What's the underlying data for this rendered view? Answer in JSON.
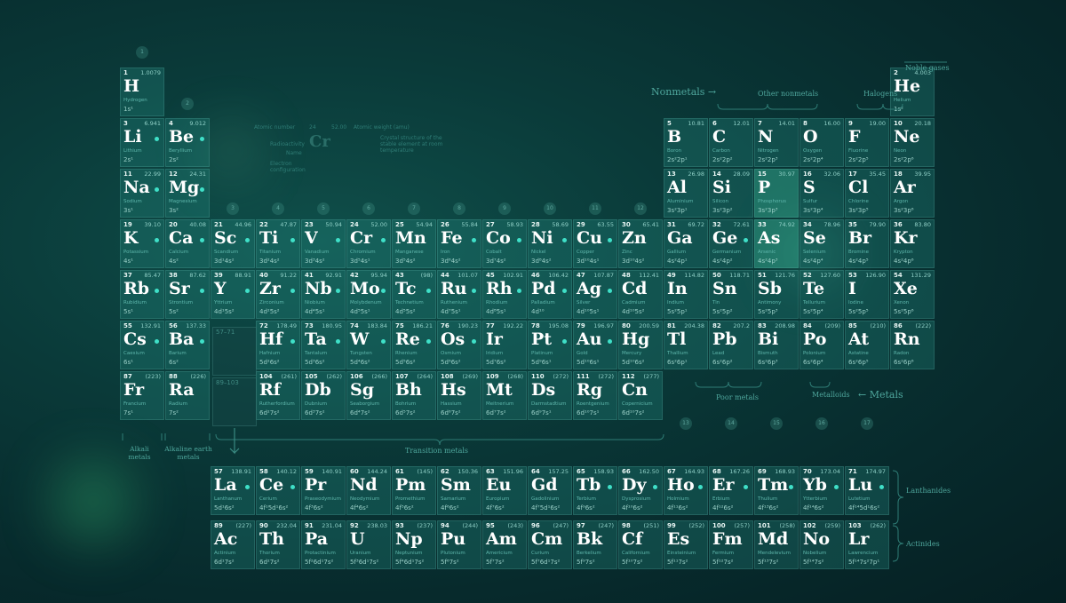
{
  "labels": {
    "noble_gases": "Noble gases",
    "nonmetals": "Nonmetals →",
    "other_nonmetals": "Other nonmetals",
    "halogens": "Halogens",
    "metals": "← Metals",
    "metalloids": "Metalloids",
    "poor_metals": "Poor metals",
    "transition_metals": "Transition metals",
    "alkali_metals": "Alkali metals",
    "alkaline_earth_metals": "Alkaline earth metals",
    "lanthanides": "Lanthanides",
    "actinides": "Actinides",
    "placeholder_la": "57–71",
    "placeholder_ac": "89–103"
  },
  "legend": {
    "atomic_number": "Atomic number",
    "atomic_weight": "Atomic weight (amu)",
    "radioactivity": "Radioactivity",
    "name": "Name",
    "electron_configuration": "Electron configuration",
    "crystal_structure": "Crystal structure of the stable element at room temperature",
    "symbol": "Cr",
    "num": "24",
    "mass": "52.00"
  },
  "group_numbers": [
    {
      "g": "1",
      "c": 0
    },
    {
      "g": "2",
      "c": 1
    },
    {
      "g": "3",
      "c": 2
    },
    {
      "g": "4",
      "c": 3
    },
    {
      "g": "5",
      "c": 4
    },
    {
      "g": "6",
      "c": 5
    },
    {
      "g": "7",
      "c": 6
    },
    {
      "g": "8",
      "c": 7
    },
    {
      "g": "9",
      "c": 8
    },
    {
      "g": "10",
      "c": 9
    },
    {
      "g": "11",
      "c": 10
    },
    {
      "g": "12",
      "c": 11
    },
    {
      "g": "13",
      "c": 12
    },
    {
      "g": "14",
      "c": 13
    },
    {
      "g": "15",
      "c": 14
    },
    {
      "g": "16",
      "c": 15
    },
    {
      "g": "17",
      "c": 16
    }
  ],
  "elements": [
    {
      "n": 1,
      "s": "H",
      "name": "Hydrogen",
      "m": "1.0079",
      "cfg": "1s¹",
      "c": 0,
      "r": 0
    },
    {
      "n": 2,
      "s": "He",
      "name": "Helium",
      "m": "4.003",
      "cfg": "1s²",
      "c": 17,
      "r": 0
    },
    {
      "n": 3,
      "s": "Li",
      "name": "Lithium",
      "m": "6.941",
      "cfg": "2s¹",
      "c": 0,
      "r": 1,
      "dot": true
    },
    {
      "n": 4,
      "s": "Be",
      "name": "Beryllium",
      "m": "9.012",
      "cfg": "2s²",
      "c": 1,
      "r": 1,
      "dot": true
    },
    {
      "n": 5,
      "s": "B",
      "name": "Boron",
      "m": "10.81",
      "cfg": "2s²2p¹",
      "c": 12,
      "r": 1
    },
    {
      "n": 6,
      "s": "C",
      "name": "Carbon",
      "m": "12.01",
      "cfg": "2s²2p²",
      "c": 13,
      "r": 1
    },
    {
      "n": 7,
      "s": "N",
      "name": "Nitrogen",
      "m": "14.01",
      "cfg": "2s²2p³",
      "c": 14,
      "r": 1
    },
    {
      "n": 8,
      "s": "O",
      "name": "Oxygen",
      "m": "16.00",
      "cfg": "2s²2p⁴",
      "c": 15,
      "r": 1
    },
    {
      "n": 9,
      "s": "F",
      "name": "Fluorine",
      "m": "19.00",
      "cfg": "2s²2p⁵",
      "c": 16,
      "r": 1
    },
    {
      "n": 10,
      "s": "Ne",
      "name": "Neon",
      "m": "20.18",
      "cfg": "2s²2p⁶",
      "c": 17,
      "r": 1
    },
    {
      "n": 11,
      "s": "Na",
      "name": "Sodium",
      "m": "22.99",
      "cfg": "3s¹",
      "c": 0,
      "r": 2,
      "dot": true
    },
    {
      "n": 12,
      "s": "Mg",
      "name": "Magnesium",
      "m": "24.31",
      "cfg": "3s²",
      "c": 1,
      "r": 2,
      "dot": true
    },
    {
      "n": 13,
      "s": "Al",
      "name": "Aluminium",
      "m": "26.98",
      "cfg": "3s²3p¹",
      "c": 12,
      "r": 2
    },
    {
      "n": 14,
      "s": "Si",
      "name": "Silicon",
      "m": "28.09",
      "cfg": "3s²3p²",
      "c": 13,
      "r": 2
    },
    {
      "n": 15,
      "s": "P",
      "name": "Phosphorus",
      "m": "30.97",
      "cfg": "3s²3p³",
      "c": 14,
      "r": 2,
      "hl": true
    },
    {
      "n": 16,
      "s": "S",
      "name": "Sulfur",
      "m": "32.06",
      "cfg": "3s²3p⁴",
      "c": 15,
      "r": 2
    },
    {
      "n": 17,
      "s": "Cl",
      "name": "Chlorine",
      "m": "35.45",
      "cfg": "3s²3p⁵",
      "c": 16,
      "r": 2
    },
    {
      "n": 18,
      "s": "Ar",
      "name": "Argon",
      "m": "39.95",
      "cfg": "3s²3p⁶",
      "c": 17,
      "r": 2
    },
    {
      "n": 19,
      "s": "K",
      "name": "Potassium",
      "m": "39.10",
      "cfg": "4s¹",
      "c": 0,
      "r": 3,
      "dot": true
    },
    {
      "n": 20,
      "s": "Ca",
      "name": "Calcium",
      "m": "40.08",
      "cfg": "4s²",
      "c": 1,
      "r": 3,
      "dot": true
    },
    {
      "n": 21,
      "s": "Sc",
      "name": "Scandium",
      "m": "44.96",
      "cfg": "3d¹4s²",
      "c": 2,
      "r": 3,
      "dot": true
    },
    {
      "n": 22,
      "s": "Ti",
      "name": "Titanium",
      "m": "47.87",
      "cfg": "3d²4s²",
      "c": 3,
      "r": 3,
      "dot": true
    },
    {
      "n": 23,
      "s": "V",
      "name": "Vanadium",
      "m": "50.94",
      "cfg": "3d³4s²",
      "c": 4,
      "r": 3,
      "dot": true
    },
    {
      "n": 24,
      "s": "Cr",
      "name": "Chromium",
      "m": "52.00",
      "cfg": "3d⁵4s¹",
      "c": 5,
      "r": 3,
      "dot": true
    },
    {
      "n": 25,
      "s": "Mn",
      "name": "Manganese",
      "m": "54.94",
      "cfg": "3d⁵4s²",
      "c": 6,
      "r": 3
    },
    {
      "n": 26,
      "s": "Fe",
      "name": "Iron",
      "m": "55.84",
      "cfg": "3d⁶4s²",
      "c": 7,
      "r": 3,
      "dot": true
    },
    {
      "n": 27,
      "s": "Co",
      "name": "Cobalt",
      "m": "58.93",
      "cfg": "3d⁷4s²",
      "c": 8,
      "r": 3,
      "dot": true
    },
    {
      "n": 28,
      "s": "Ni",
      "name": "Nickel",
      "m": "58.69",
      "cfg": "3d⁸4s²",
      "c": 9,
      "r": 3,
      "dot": true
    },
    {
      "n": 29,
      "s": "Cu",
      "name": "Copper",
      "m": "63.55",
      "cfg": "3d¹⁰4s¹",
      "c": 10,
      "r": 3,
      "dot": true
    },
    {
      "n": 30,
      "s": "Zn",
      "name": "Zinc",
      "m": "65.41",
      "cfg": "3d¹⁰4s²",
      "c": 11,
      "r": 3
    },
    {
      "n": 31,
      "s": "Ga",
      "name": "Gallium",
      "m": "69.72",
      "cfg": "4s²4p¹",
      "c": 12,
      "r": 3
    },
    {
      "n": 32,
      "s": "Ge",
      "name": "Germanium",
      "m": "72.61",
      "cfg": "4s²4p²",
      "c": 13,
      "r": 3,
      "dot": true
    },
    {
      "n": 33,
      "s": "As",
      "name": "Arsenic",
      "m": "74.92",
      "cfg": "4s²4p³",
      "c": 14,
      "r": 3,
      "hl": true
    },
    {
      "n": 34,
      "s": "Se",
      "name": "Selenium",
      "m": "78.96",
      "cfg": "4s²4p⁴",
      "c": 15,
      "r": 3
    },
    {
      "n": 35,
      "s": "Br",
      "name": "Bromine",
      "m": "79.90",
      "cfg": "4s²4p⁵",
      "c": 16,
      "r": 3
    },
    {
      "n": 36,
      "s": "Kr",
      "name": "Krypton",
      "m": "83.80",
      "cfg": "4s²4p⁶",
      "c": 17,
      "r": 3
    },
    {
      "n": 37,
      "s": "Rb",
      "name": "Rubidium",
      "m": "85.47",
      "cfg": "5s¹",
      "c": 0,
      "r": 4,
      "dot": true
    },
    {
      "n": 38,
      "s": "Sr",
      "name": "Strontium",
      "m": "87.62",
      "cfg": "5s²",
      "c": 1,
      "r": 4,
      "dot": true
    },
    {
      "n": 39,
      "s": "Y",
      "name": "Yttrium",
      "m": "88.91",
      "cfg": "4d¹5s²",
      "c": 2,
      "r": 4,
      "dot": true
    },
    {
      "n": 40,
      "s": "Zr",
      "name": "Zirconium",
      "m": "91.22",
      "cfg": "4d²5s²",
      "c": 3,
      "r": 4,
      "dot": true
    },
    {
      "n": 41,
      "s": "Nb",
      "name": "Niobium",
      "m": "92.91",
      "cfg": "4d⁴5s¹",
      "c": 4,
      "r": 4,
      "dot": true
    },
    {
      "n": 42,
      "s": "Mo",
      "name": "Molybdenum",
      "m": "95.94",
      "cfg": "4d⁵5s¹",
      "c": 5,
      "r": 4,
      "dot": true
    },
    {
      "n": 43,
      "s": "Tc",
      "name": "Technetium",
      "m": "(98)",
      "cfg": "4d⁵5s²",
      "c": 6,
      "r": 4,
      "dot": true
    },
    {
      "n": 44,
      "s": "Ru",
      "name": "Ruthenium",
      "m": "101.07",
      "cfg": "4d⁷5s¹",
      "c": 7,
      "r": 4,
      "dot": true
    },
    {
      "n": 45,
      "s": "Rh",
      "name": "Rhodium",
      "m": "102.91",
      "cfg": "4d⁸5s¹",
      "c": 8,
      "r": 4,
      "dot": true
    },
    {
      "n": 46,
      "s": "Pd",
      "name": "Palladium",
      "m": "106.42",
      "cfg": "4d¹⁰",
      "c": 9,
      "r": 4,
      "dot": true
    },
    {
      "n": 47,
      "s": "Ag",
      "name": "Silver",
      "m": "107.87",
      "cfg": "4d¹⁰5s¹",
      "c": 10,
      "r": 4,
      "dot": true
    },
    {
      "n": 48,
      "s": "Cd",
      "name": "Cadmium",
      "m": "112.41",
      "cfg": "4d¹⁰5s²",
      "c": 11,
      "r": 4
    },
    {
      "n": 49,
      "s": "In",
      "name": "Indium",
      "m": "114.82",
      "cfg": "5s²5p¹",
      "c": 12,
      "r": 4
    },
    {
      "n": 50,
      "s": "Sn",
      "name": "Tin",
      "m": "118.71",
      "cfg": "5s²5p²",
      "c": 13,
      "r": 4
    },
    {
      "n": 51,
      "s": "Sb",
      "name": "Antimony",
      "m": "121.76",
      "cfg": "5s²5p³",
      "c": 14,
      "r": 4
    },
    {
      "n": 52,
      "s": "Te",
      "name": "Tellurium",
      "m": "127.60",
      "cfg": "5s²5p⁴",
      "c": 15,
      "r": 4
    },
    {
      "n": 53,
      "s": "I",
      "name": "Iodine",
      "m": "126.90",
      "cfg": "5s²5p⁵",
      "c": 16,
      "r": 4
    },
    {
      "n": 54,
      "s": "Xe",
      "name": "Xenon",
      "m": "131.29",
      "cfg": "5s²5p⁶",
      "c": 17,
      "r": 4
    },
    {
      "n": 55,
      "s": "Cs",
      "name": "Caesium",
      "m": "132.91",
      "cfg": "6s¹",
      "c": 0,
      "r": 5,
      "dot": true
    },
    {
      "n": 56,
      "s": "Ba",
      "name": "Barium",
      "m": "137.33",
      "cfg": "6s²",
      "c": 1,
      "r": 5,
      "dot": true
    },
    {
      "n": 72,
      "s": "Hf",
      "name": "Hafnium",
      "m": "178.49",
      "cfg": "5d²6s²",
      "c": 3,
      "r": 5,
      "dot": true
    },
    {
      "n": 73,
      "s": "Ta",
      "name": "Tantalum",
      "m": "180.95",
      "cfg": "5d³6s²",
      "c": 4,
      "r": 5,
      "dot": true
    },
    {
      "n": 74,
      "s": "W",
      "name": "Tungsten",
      "m": "183.84",
      "cfg": "5d⁴6s²",
      "c": 5,
      "r": 5,
      "dot": true
    },
    {
      "n": 75,
      "s": "Re",
      "name": "Rhenium",
      "m": "186.21",
      "cfg": "5d⁵6s²",
      "c": 6,
      "r": 5,
      "dot": true
    },
    {
      "n": 76,
      "s": "Os",
      "name": "Osmium",
      "m": "190.23",
      "cfg": "5d⁶6s²",
      "c": 7,
      "r": 5,
      "dot": true
    },
    {
      "n": 77,
      "s": "Ir",
      "name": "Iridium",
      "m": "192.22",
      "cfg": "5d⁷6s²",
      "c": 8,
      "r": 5
    },
    {
      "n": 78,
      "s": "Pt",
      "name": "Platinum",
      "m": "195.08",
      "cfg": "5d⁹6s¹",
      "c": 9,
      "r": 5,
      "dot": true
    },
    {
      "n": 79,
      "s": "Au",
      "name": "Gold",
      "m": "196.97",
      "cfg": "5d¹⁰6s¹",
      "c": 10,
      "r": 5,
      "dot": true
    },
    {
      "n": 80,
      "s": "Hg",
      "name": "Mercury",
      "m": "200.59",
      "cfg": "5d¹⁰6s²",
      "c": 11,
      "r": 5
    },
    {
      "n": 81,
      "s": "Tl",
      "name": "Thallium",
      "m": "204.38",
      "cfg": "6s²6p¹",
      "c": 12,
      "r": 5
    },
    {
      "n": 82,
      "s": "Pb",
      "name": "Lead",
      "m": "207.2",
      "cfg": "6s²6p²",
      "c": 13,
      "r": 5
    },
    {
      "n": 83,
      "s": "Bi",
      "name": "Bismuth",
      "m": "208.98",
      "cfg": "6s²6p³",
      "c": 14,
      "r": 5
    },
    {
      "n": 84,
      "s": "Po",
      "name": "Polonium",
      "m": "(209)",
      "cfg": "6s²6p⁴",
      "c": 15,
      "r": 5
    },
    {
      "n": 85,
      "s": "At",
      "name": "Astatine",
      "m": "(210)",
      "cfg": "6s²6p⁵",
      "c": 16,
      "r": 5
    },
    {
      "n": 86,
      "s": "Rn",
      "name": "Radon",
      "m": "(222)",
      "cfg": "6s²6p⁶",
      "c": 17,
      "r": 5
    },
    {
      "n": 87,
      "s": "Fr",
      "name": "Francium",
      "m": "(223)",
      "cfg": "7s¹",
      "c": 0,
      "r": 6
    },
    {
      "n": 88,
      "s": "Ra",
      "name": "Radium",
      "m": "(226)",
      "cfg": "7s²",
      "c": 1,
      "r": 6
    },
    {
      "n": 104,
      "s": "Rf",
      "name": "Rutherfordium",
      "m": "(261)",
      "cfg": "6d²7s²",
      "c": 3,
      "r": 6
    },
    {
      "n": 105,
      "s": "Db",
      "name": "Dubnium",
      "m": "(262)",
      "cfg": "6d³7s²",
      "c": 4,
      "r": 6
    },
    {
      "n": 106,
      "s": "Sg",
      "name": "Seaborgium",
      "m": "(266)",
      "cfg": "6d⁴7s²",
      "c": 5,
      "r": 6
    },
    {
      "n": 107,
      "s": "Bh",
      "name": "Bohrium",
      "m": "(264)",
      "cfg": "6d⁵7s²",
      "c": 6,
      "r": 6
    },
    {
      "n": 108,
      "s": "Hs",
      "name": "Hassium",
      "m": "(269)",
      "cfg": "6d⁶7s²",
      "c": 7,
      "r": 6
    },
    {
      "n": 109,
      "s": "Mt",
      "name": "Meitnerium",
      "m": "(268)",
      "cfg": "6d⁷7s²",
      "c": 8,
      "r": 6
    },
    {
      "n": 110,
      "s": "Ds",
      "name": "Darmstadtium",
      "m": "(272)",
      "cfg": "6d⁹7s¹",
      "c": 9,
      "r": 6
    },
    {
      "n": 111,
      "s": "Rg",
      "name": "Roentgenium",
      "m": "(272)",
      "cfg": "6d¹⁰7s¹",
      "c": 10,
      "r": 6
    },
    {
      "n": 112,
      "s": "Cn",
      "name": "Copernicium",
      "m": "(277)",
      "cfg": "6d¹⁰7s²",
      "c": 11,
      "r": 6
    },
    {
      "n": 57,
      "s": "La",
      "name": "Lanthanum",
      "m": "138.91",
      "cfg": "5d¹6s²",
      "c": 2,
      "r": 7,
      "dot": true
    },
    {
      "n": 58,
      "s": "Ce",
      "name": "Cerium",
      "m": "140.12",
      "cfg": "4f¹5d¹6s²",
      "c": 3,
      "r": 7,
      "dot": true
    },
    {
      "n": 59,
      "s": "Pr",
      "name": "Praseodymium",
      "m": "140.91",
      "cfg": "4f³6s²",
      "c": 4,
      "r": 7
    },
    {
      "n": 60,
      "s": "Nd",
      "name": "Neodymium",
      "m": "144.24",
      "cfg": "4f⁴6s²",
      "c": 5,
      "r": 7
    },
    {
      "n": 61,
      "s": "Pm",
      "name": "Promethium",
      "m": "(145)",
      "cfg": "4f⁵6s²",
      "c": 6,
      "r": 7
    },
    {
      "n": 62,
      "s": "Sm",
      "name": "Samarium",
      "m": "150.36",
      "cfg": "4f⁶6s²",
      "c": 7,
      "r": 7
    },
    {
      "n": 63,
      "s": "Eu",
      "name": "Europium",
      "m": "151.96",
      "cfg": "4f⁷6s²",
      "c": 8,
      "r": 7
    },
    {
      "n": 64,
      "s": "Gd",
      "name": "Gadolinium",
      "m": "157.25",
      "cfg": "4f⁷5d¹6s²",
      "c": 9,
      "r": 7
    },
    {
      "n": 65,
      "s": "Tb",
      "name": "Terbium",
      "m": "158.93",
      "cfg": "4f⁹6s²",
      "c": 10,
      "r": 7,
      "dot": true
    },
    {
      "n": 66,
      "s": "Dy",
      "name": "Dysprosium",
      "m": "162.50",
      "cfg": "4f¹⁰6s²",
      "c": 11,
      "r": 7,
      "dot": true
    },
    {
      "n": 67,
      "s": "Ho",
      "name": "Holmium",
      "m": "164.93",
      "cfg": "4f¹¹6s²",
      "c": 12,
      "r": 7,
      "dot": true
    },
    {
      "n": 68,
      "s": "Er",
      "name": "Erbium",
      "m": "167.26",
      "cfg": "4f¹²6s²",
      "c": 13,
      "r": 7,
      "dot": true
    },
    {
      "n": 69,
      "s": "Tm",
      "name": "Thulium",
      "m": "168.93",
      "cfg": "4f¹³6s²",
      "c": 14,
      "r": 7,
      "dot": true
    },
    {
      "n": 70,
      "s": "Yb",
      "name": "Ytterbium",
      "m": "173.04",
      "cfg": "4f¹⁴6s²",
      "c": 15,
      "r": 7,
      "dot": true
    },
    {
      "n": 71,
      "s": "Lu",
      "name": "Lutetium",
      "m": "174.97",
      "cfg": "4f¹⁴5d¹6s²",
      "c": 16,
      "r": 7,
      "dot": true
    },
    {
      "n": 89,
      "s": "Ac",
      "name": "Actinium",
      "m": "(227)",
      "cfg": "6d¹7s²",
      "c": 2,
      "r": 8
    },
    {
      "n": 90,
      "s": "Th",
      "name": "Thorium",
      "m": "232.04",
      "cfg": "6d²7s²",
      "c": 3,
      "r": 8
    },
    {
      "n": 91,
      "s": "Pa",
      "name": "Protactinium",
      "m": "231.04",
      "cfg": "5f²6d¹7s²",
      "c": 4,
      "r": 8
    },
    {
      "n": 92,
      "s": "U",
      "name": "Uranium",
      "m": "238.03",
      "cfg": "5f³6d¹7s²",
      "c": 5,
      "r": 8
    },
    {
      "n": 93,
      "s": "Np",
      "name": "Neptunium",
      "m": "(237)",
      "cfg": "5f⁴6d¹7s²",
      "c": 6,
      "r": 8
    },
    {
      "n": 94,
      "s": "Pu",
      "name": "Plutonium",
      "m": "(244)",
      "cfg": "5f⁶7s²",
      "c": 7,
      "r": 8
    },
    {
      "n": 95,
      "s": "Am",
      "name": "Americium",
      "m": "(243)",
      "cfg": "5f⁷7s²",
      "c": 8,
      "r": 8
    },
    {
      "n": 96,
      "s": "Cm",
      "name": "Curium",
      "m": "(247)",
      "cfg": "5f⁷6d¹7s²",
      "c": 9,
      "r": 8
    },
    {
      "n": 97,
      "s": "Bk",
      "name": "Berkelium",
      "m": "(247)",
      "cfg": "5f⁹7s²",
      "c": 10,
      "r": 8
    },
    {
      "n": 98,
      "s": "Cf",
      "name": "Californium",
      "m": "(251)",
      "cfg": "5f¹⁰7s²",
      "c": 11,
      "r": 8
    },
    {
      "n": 99,
      "s": "Es",
      "name": "Einsteinium",
      "m": "(252)",
      "cfg": "5f¹¹7s²",
      "c": 12,
      "r": 8
    },
    {
      "n": 100,
      "s": "Fm",
      "name": "Fermium",
      "m": "(257)",
      "cfg": "5f¹²7s²",
      "c": 13,
      "r": 8
    },
    {
      "n": 101,
      "s": "Md",
      "name": "Mendelevium",
      "m": "(258)",
      "cfg": "5f¹³7s²",
      "c": 14,
      "r": 8
    },
    {
      "n": 102,
      "s": "No",
      "name": "Nobelium",
      "m": "(259)",
      "cfg": "5f¹⁴7s²",
      "c": 15,
      "r": 8
    },
    {
      "n": 103,
      "s": "Lr",
      "name": "Lawrencium",
      "m": "(262)",
      "cfg": "5f¹⁴7s²7p¹",
      "c": 16,
      "r": 8
    }
  ]
}
